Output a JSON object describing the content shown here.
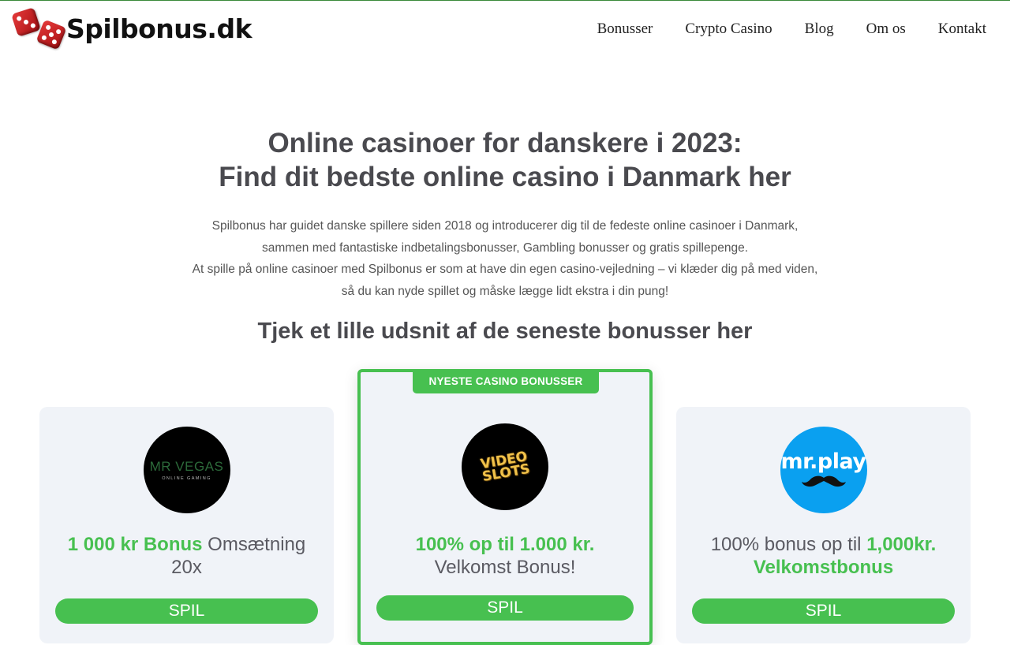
{
  "site": {
    "logo_text": "Spilbonus.dk"
  },
  "nav": {
    "items": [
      {
        "label": "Bonusser"
      },
      {
        "label": "Crypto Casino"
      },
      {
        "label": "Blog"
      },
      {
        "label": "Om os"
      },
      {
        "label": "Kontakt"
      }
    ]
  },
  "hero": {
    "title_line1": "Online casinoer for danskere i 2023:",
    "title_line2": "Find dit bedste online casino i Danmark her",
    "intro_lines": [
      "Spilbonus har guidet danske spillere siden 2018 og introducerer dig til de fedeste online casinoer i Danmark,",
      "sammen med fantastiske indbetalingsbonusser, Gambling bonusser og gratis spillepenge.",
      "At spille på online casinoer med Spilbonus er som at have din egen casino-vejledning – vi klæder dig på med viden,",
      "så du kan nyde spillet og måske lægge lidt ekstra i din pung!"
    ],
    "subheading": "Tjek et lille udsnit af de seneste bonusser her"
  },
  "cards": [
    {
      "logo_main": "MR VEGAS",
      "logo_sub": "ONLINE GAMING",
      "offer_highlight": "1 000 kr Bonus",
      "offer_rest": " Omsætning 20x",
      "button": "SPIL"
    },
    {
      "ribbon": "NYESTE CASINO BONUSSER",
      "logo_main": "VIDEO SLOTS",
      "offer_highlight": "100% op til 1.000 kr.",
      "offer_rest": " Velkomst Bonus!",
      "button": "SPIL"
    },
    {
      "logo_main": "mr.play",
      "offer_prefix": "100% bonus op til ",
      "offer_highlight": "1,000kr. Velkomstbonus",
      "button": "SPIL"
    }
  ],
  "colors": {
    "accent_green": "#47c050",
    "card_bg": "#f0f3f8",
    "heading": "#4a4a4f",
    "mrplay_blue": "#0aa0f0"
  }
}
